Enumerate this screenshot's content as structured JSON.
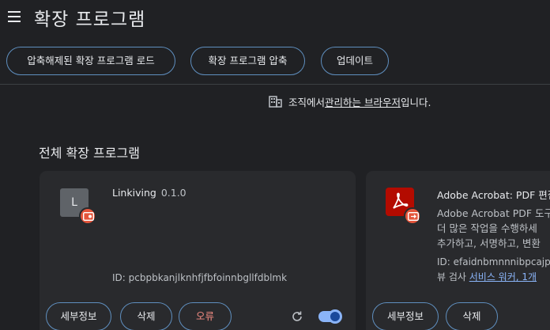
{
  "header": {
    "title": "확장 프로그램",
    "buttons": {
      "load_unpacked": "압축해제된 확장 프로그램 로드",
      "pack": "확장 프로그램 압축",
      "update": "업데이트"
    }
  },
  "managed_notice": {
    "prefix": "조직에서 ",
    "link": "관리하는 브라우저",
    "suffix": "입니다."
  },
  "section_title": "전체 확장 프로그램",
  "extensions": [
    {
      "icon_letter": "L",
      "name": "Linkiving",
      "version": "0.1.0",
      "id": "ID: pcbpbkanjlknhfjfbfoinnbgllfdblmk",
      "details_label": "세부정보",
      "remove_label": "삭제",
      "errors_label": "오류",
      "enabled": true
    },
    {
      "name": "Adobe Acrobat: PDF 편집",
      "description_lines": [
        "Adobe Acrobat PDF 도구",
        "더 많은 작업을 수행하세",
        "추가하고, 서명하고, 변환"
      ],
      "id": "ID: efaidnbmnnnibpcajpc",
      "inspect_prefix": "뷰 검사 ",
      "service_worker": "서비스 워커",
      "more": ", 1개",
      "details_label": "세부정보",
      "remove_label": "삭제"
    }
  ],
  "colors": {
    "background": "#202124",
    "card": "#292a2d",
    "accent": "#8ab4f8",
    "error": "#f28b82",
    "badge": "#e4553b"
  }
}
